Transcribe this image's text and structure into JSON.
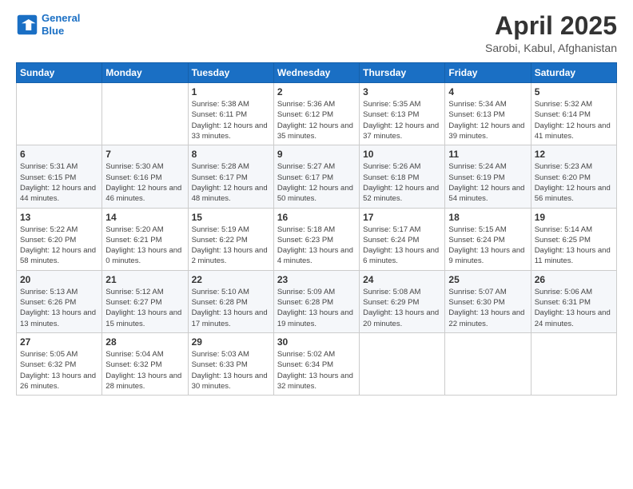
{
  "header": {
    "logo_line1": "General",
    "logo_line2": "Blue",
    "month_title": "April 2025",
    "location": "Sarobi, Kabul, Afghanistan"
  },
  "weekdays": [
    "Sunday",
    "Monday",
    "Tuesday",
    "Wednesday",
    "Thursday",
    "Friday",
    "Saturday"
  ],
  "weeks": [
    [
      {
        "day": "",
        "sunrise": "",
        "sunset": "",
        "daylight": ""
      },
      {
        "day": "",
        "sunrise": "",
        "sunset": "",
        "daylight": ""
      },
      {
        "day": "1",
        "sunrise": "Sunrise: 5:38 AM",
        "sunset": "Sunset: 6:11 PM",
        "daylight": "Daylight: 12 hours and 33 minutes."
      },
      {
        "day": "2",
        "sunrise": "Sunrise: 5:36 AM",
        "sunset": "Sunset: 6:12 PM",
        "daylight": "Daylight: 12 hours and 35 minutes."
      },
      {
        "day": "3",
        "sunrise": "Sunrise: 5:35 AM",
        "sunset": "Sunset: 6:13 PM",
        "daylight": "Daylight: 12 hours and 37 minutes."
      },
      {
        "day": "4",
        "sunrise": "Sunrise: 5:34 AM",
        "sunset": "Sunset: 6:13 PM",
        "daylight": "Daylight: 12 hours and 39 minutes."
      },
      {
        "day": "5",
        "sunrise": "Sunrise: 5:32 AM",
        "sunset": "Sunset: 6:14 PM",
        "daylight": "Daylight: 12 hours and 41 minutes."
      }
    ],
    [
      {
        "day": "6",
        "sunrise": "Sunrise: 5:31 AM",
        "sunset": "Sunset: 6:15 PM",
        "daylight": "Daylight: 12 hours and 44 minutes."
      },
      {
        "day": "7",
        "sunrise": "Sunrise: 5:30 AM",
        "sunset": "Sunset: 6:16 PM",
        "daylight": "Daylight: 12 hours and 46 minutes."
      },
      {
        "day": "8",
        "sunrise": "Sunrise: 5:28 AM",
        "sunset": "Sunset: 6:17 PM",
        "daylight": "Daylight: 12 hours and 48 minutes."
      },
      {
        "day": "9",
        "sunrise": "Sunrise: 5:27 AM",
        "sunset": "Sunset: 6:17 PM",
        "daylight": "Daylight: 12 hours and 50 minutes."
      },
      {
        "day": "10",
        "sunrise": "Sunrise: 5:26 AM",
        "sunset": "Sunset: 6:18 PM",
        "daylight": "Daylight: 12 hours and 52 minutes."
      },
      {
        "day": "11",
        "sunrise": "Sunrise: 5:24 AM",
        "sunset": "Sunset: 6:19 PM",
        "daylight": "Daylight: 12 hours and 54 minutes."
      },
      {
        "day": "12",
        "sunrise": "Sunrise: 5:23 AM",
        "sunset": "Sunset: 6:20 PM",
        "daylight": "Daylight: 12 hours and 56 minutes."
      }
    ],
    [
      {
        "day": "13",
        "sunrise": "Sunrise: 5:22 AM",
        "sunset": "Sunset: 6:20 PM",
        "daylight": "Daylight: 12 hours and 58 minutes."
      },
      {
        "day": "14",
        "sunrise": "Sunrise: 5:20 AM",
        "sunset": "Sunset: 6:21 PM",
        "daylight": "Daylight: 13 hours and 0 minutes."
      },
      {
        "day": "15",
        "sunrise": "Sunrise: 5:19 AM",
        "sunset": "Sunset: 6:22 PM",
        "daylight": "Daylight: 13 hours and 2 minutes."
      },
      {
        "day": "16",
        "sunrise": "Sunrise: 5:18 AM",
        "sunset": "Sunset: 6:23 PM",
        "daylight": "Daylight: 13 hours and 4 minutes."
      },
      {
        "day": "17",
        "sunrise": "Sunrise: 5:17 AM",
        "sunset": "Sunset: 6:24 PM",
        "daylight": "Daylight: 13 hours and 6 minutes."
      },
      {
        "day": "18",
        "sunrise": "Sunrise: 5:15 AM",
        "sunset": "Sunset: 6:24 PM",
        "daylight": "Daylight: 13 hours and 9 minutes."
      },
      {
        "day": "19",
        "sunrise": "Sunrise: 5:14 AM",
        "sunset": "Sunset: 6:25 PM",
        "daylight": "Daylight: 13 hours and 11 minutes."
      }
    ],
    [
      {
        "day": "20",
        "sunrise": "Sunrise: 5:13 AM",
        "sunset": "Sunset: 6:26 PM",
        "daylight": "Daylight: 13 hours and 13 minutes."
      },
      {
        "day": "21",
        "sunrise": "Sunrise: 5:12 AM",
        "sunset": "Sunset: 6:27 PM",
        "daylight": "Daylight: 13 hours and 15 minutes."
      },
      {
        "day": "22",
        "sunrise": "Sunrise: 5:10 AM",
        "sunset": "Sunset: 6:28 PM",
        "daylight": "Daylight: 13 hours and 17 minutes."
      },
      {
        "day": "23",
        "sunrise": "Sunrise: 5:09 AM",
        "sunset": "Sunset: 6:28 PM",
        "daylight": "Daylight: 13 hours and 19 minutes."
      },
      {
        "day": "24",
        "sunrise": "Sunrise: 5:08 AM",
        "sunset": "Sunset: 6:29 PM",
        "daylight": "Daylight: 13 hours and 20 minutes."
      },
      {
        "day": "25",
        "sunrise": "Sunrise: 5:07 AM",
        "sunset": "Sunset: 6:30 PM",
        "daylight": "Daylight: 13 hours and 22 minutes."
      },
      {
        "day": "26",
        "sunrise": "Sunrise: 5:06 AM",
        "sunset": "Sunset: 6:31 PM",
        "daylight": "Daylight: 13 hours and 24 minutes."
      }
    ],
    [
      {
        "day": "27",
        "sunrise": "Sunrise: 5:05 AM",
        "sunset": "Sunset: 6:32 PM",
        "daylight": "Daylight: 13 hours and 26 minutes."
      },
      {
        "day": "28",
        "sunrise": "Sunrise: 5:04 AM",
        "sunset": "Sunset: 6:32 PM",
        "daylight": "Daylight: 13 hours and 28 minutes."
      },
      {
        "day": "29",
        "sunrise": "Sunrise: 5:03 AM",
        "sunset": "Sunset: 6:33 PM",
        "daylight": "Daylight: 13 hours and 30 minutes."
      },
      {
        "day": "30",
        "sunrise": "Sunrise: 5:02 AM",
        "sunset": "Sunset: 6:34 PM",
        "daylight": "Daylight: 13 hours and 32 minutes."
      },
      {
        "day": "",
        "sunrise": "",
        "sunset": "",
        "daylight": ""
      },
      {
        "day": "",
        "sunrise": "",
        "sunset": "",
        "daylight": ""
      },
      {
        "day": "",
        "sunrise": "",
        "sunset": "",
        "daylight": ""
      }
    ]
  ]
}
